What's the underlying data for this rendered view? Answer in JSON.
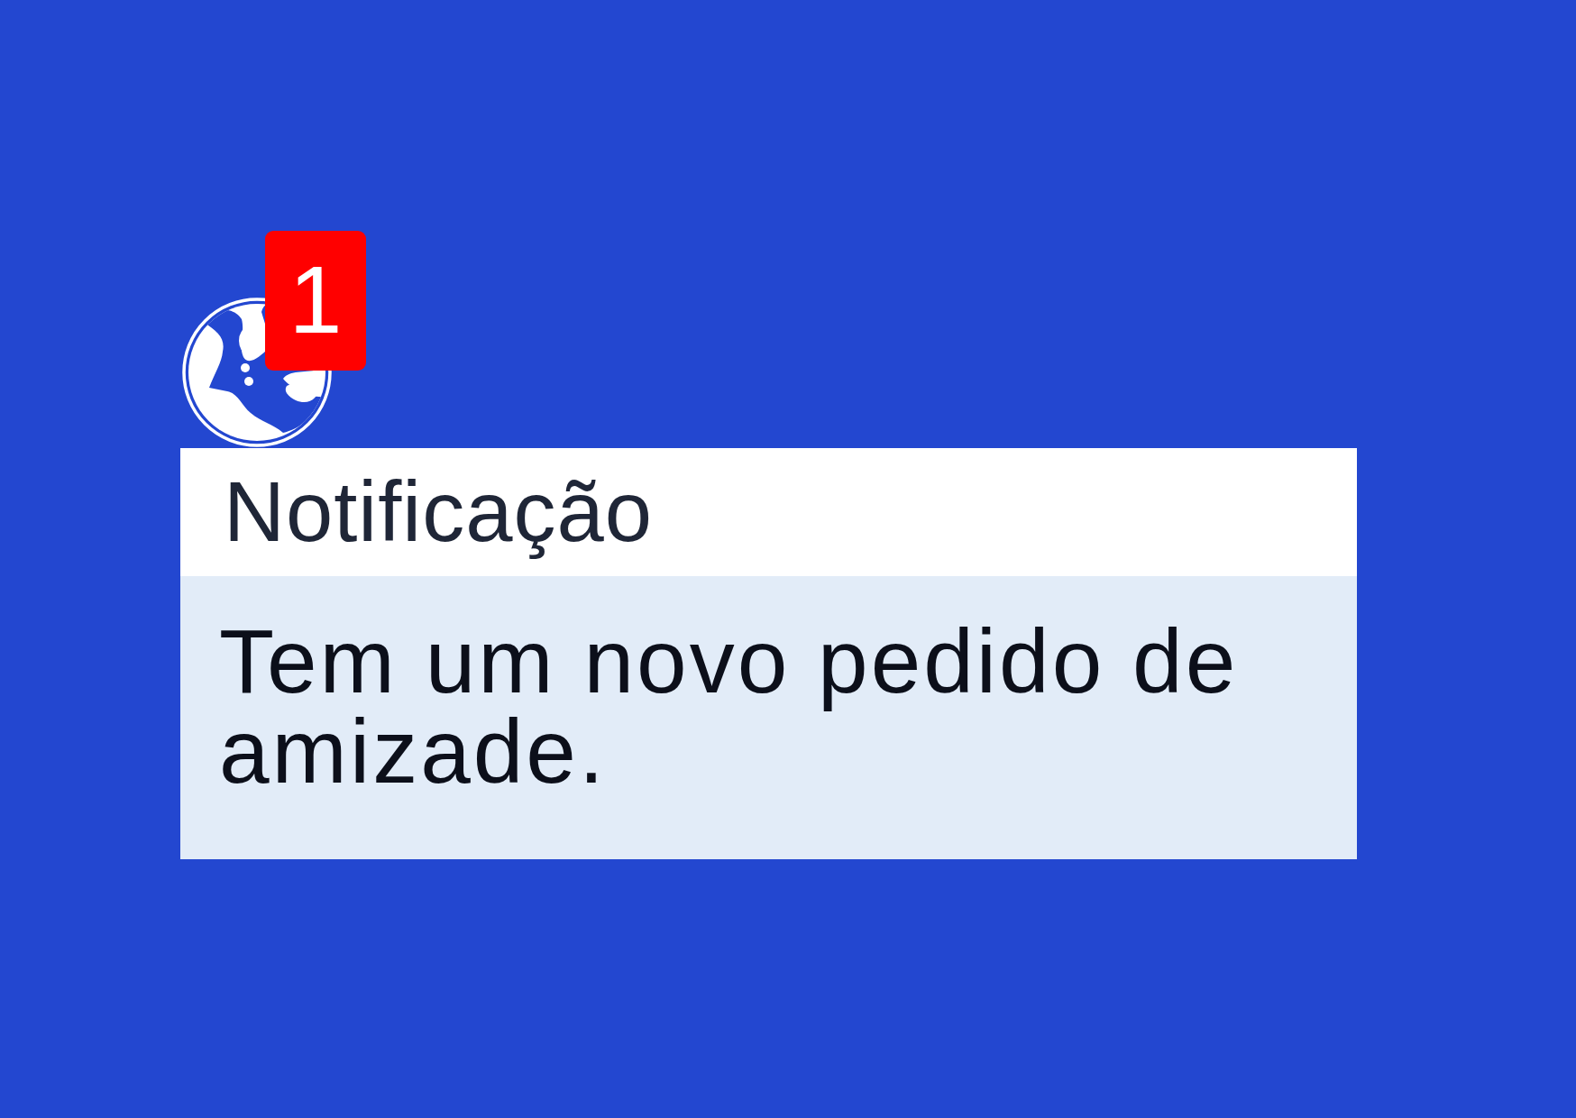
{
  "app_icon": {
    "badge": "1"
  },
  "notification": {
    "title": "Notificação",
    "message": "Tem um novo pedido de amizade."
  }
}
